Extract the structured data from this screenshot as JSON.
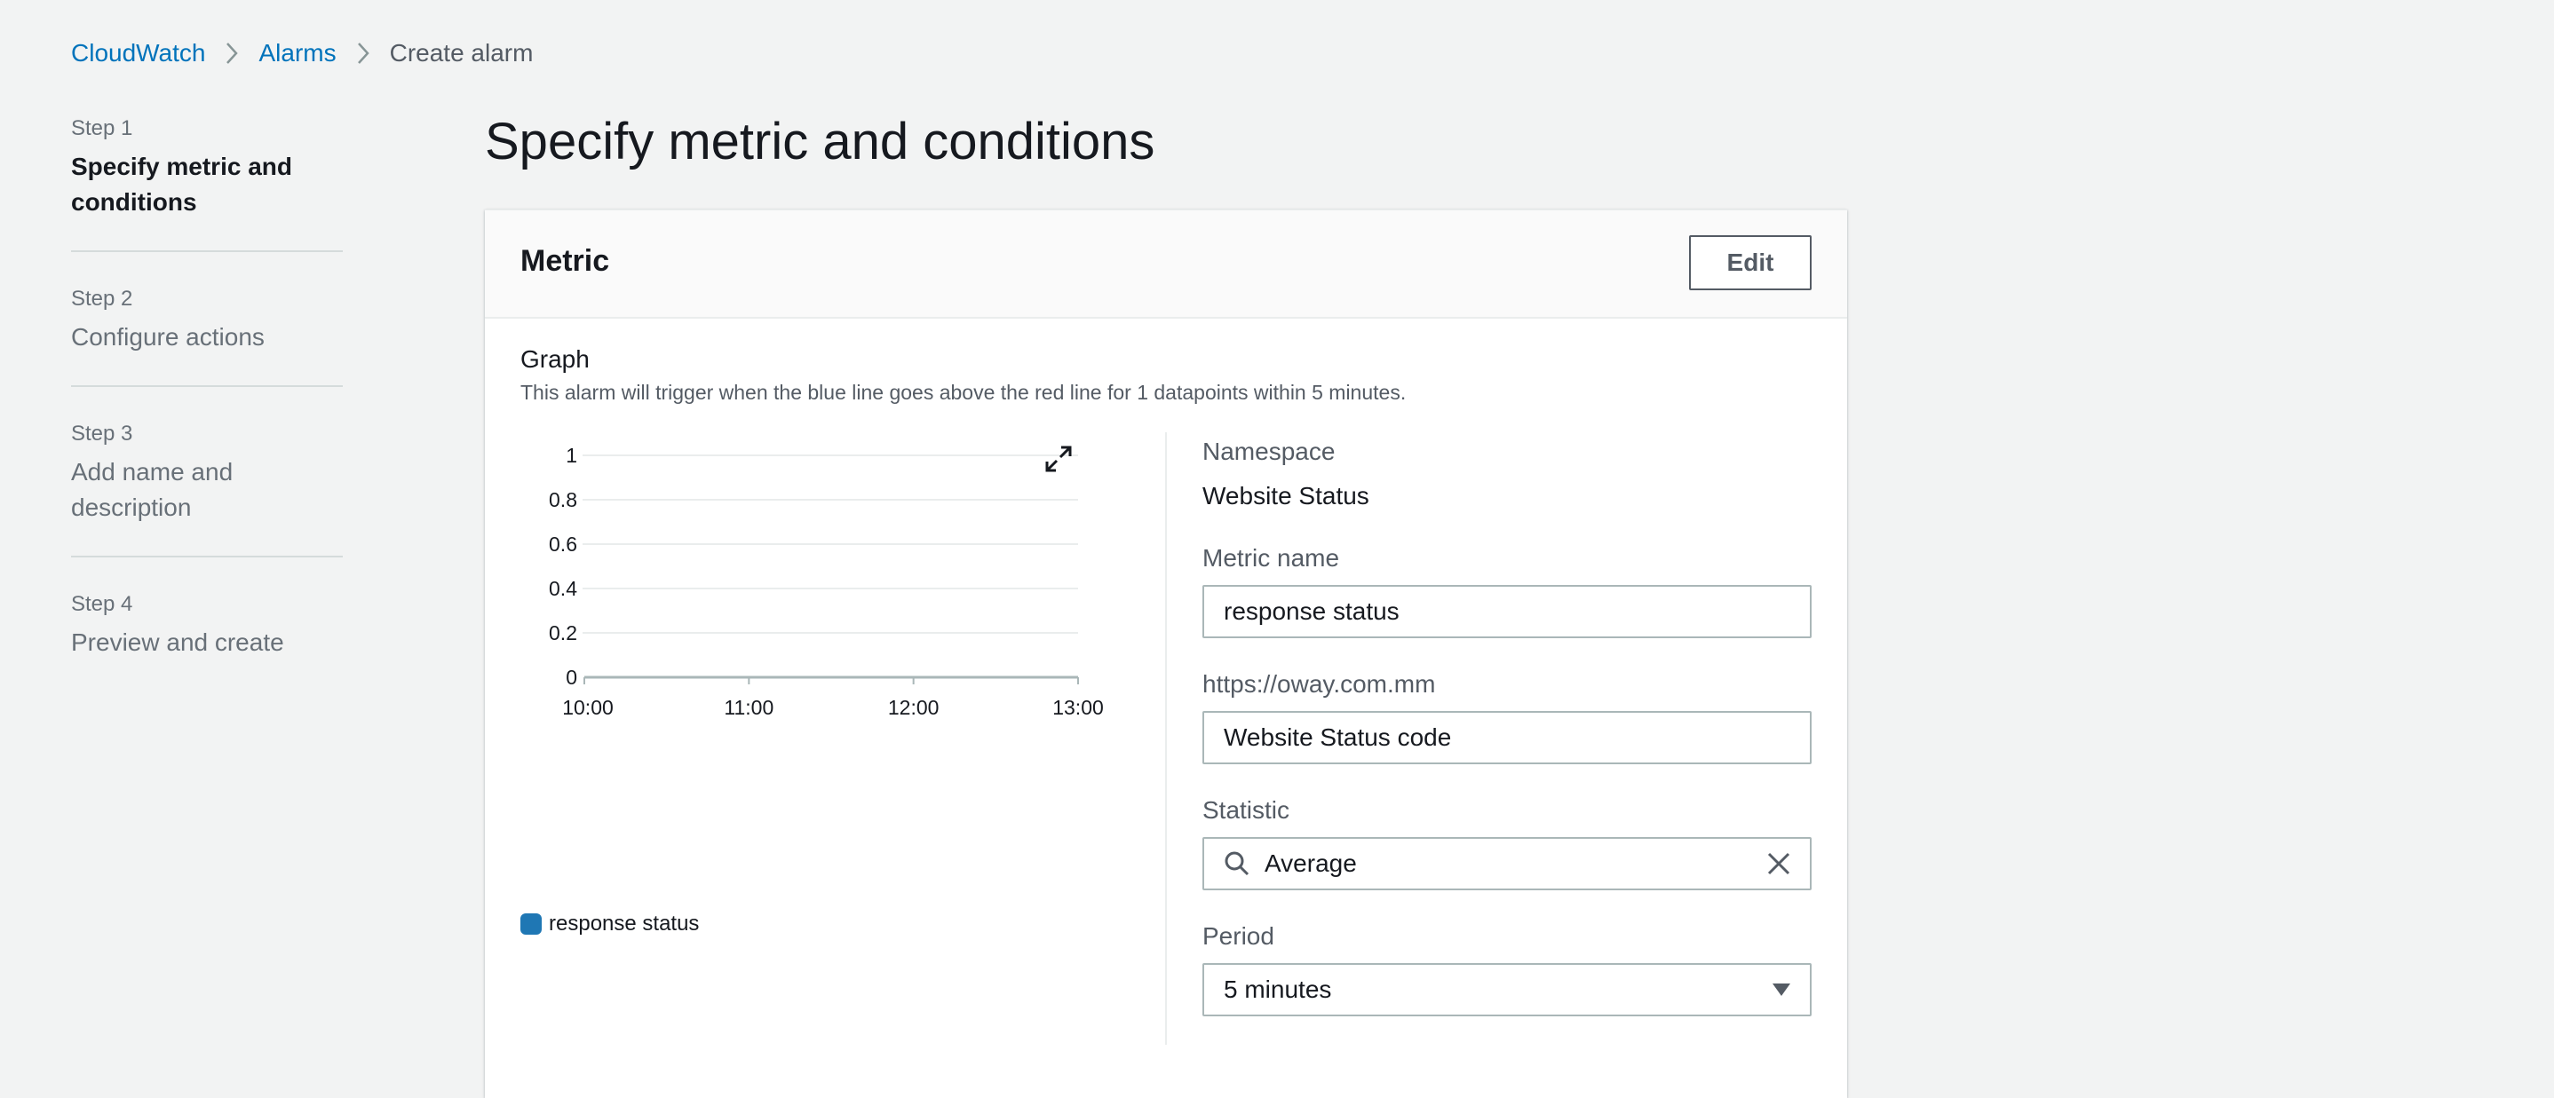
{
  "breadcrumb": {
    "items": [
      "CloudWatch",
      "Alarms",
      "Create alarm"
    ]
  },
  "steps": [
    {
      "number": "Step 1",
      "title": "Specify metric and conditions"
    },
    {
      "number": "Step 2",
      "title": "Configure actions"
    },
    {
      "number": "Step 3",
      "title": "Add name and description"
    },
    {
      "number": "Step 4",
      "title": "Preview and create"
    }
  ],
  "page": {
    "title": "Specify metric and conditions"
  },
  "metric_panel": {
    "title": "Metric",
    "edit_label": "Edit",
    "graph_label": "Graph",
    "graph_description": "This alarm will trigger when the blue line goes above the red line for 1 datapoints within 5 minutes.",
    "legend_label": "response status"
  },
  "form": {
    "namespace_label": "Namespace",
    "namespace_value": "Website Status",
    "metric_name_label": "Metric name",
    "metric_name_value": "response status",
    "dimension_label": "https://oway.com.mm",
    "dimension_value": "Website Status code",
    "statistic_label": "Statistic",
    "statistic_value": "Average",
    "period_label": "Period",
    "period_value": "5 minutes"
  },
  "icons": [
    "chevron-right-icon",
    "expand-icon",
    "search-icon",
    "clear-icon",
    "caret-down-icon"
  ],
  "colors": {
    "link": "#0073bb",
    "series": "#1f77b4",
    "edit_border": "#545b64"
  },
  "chart_data": {
    "type": "line",
    "x": [
      "10:00",
      "11:00",
      "12:00",
      "13:00"
    ],
    "series": [
      {
        "name": "response status",
        "values": []
      }
    ],
    "ylim": [
      0,
      1
    ],
    "yticks": [
      "0",
      "0.2",
      "0.4",
      "0.6",
      "0.8",
      "1"
    ],
    "grid": true,
    "legend": "bottom-left"
  }
}
